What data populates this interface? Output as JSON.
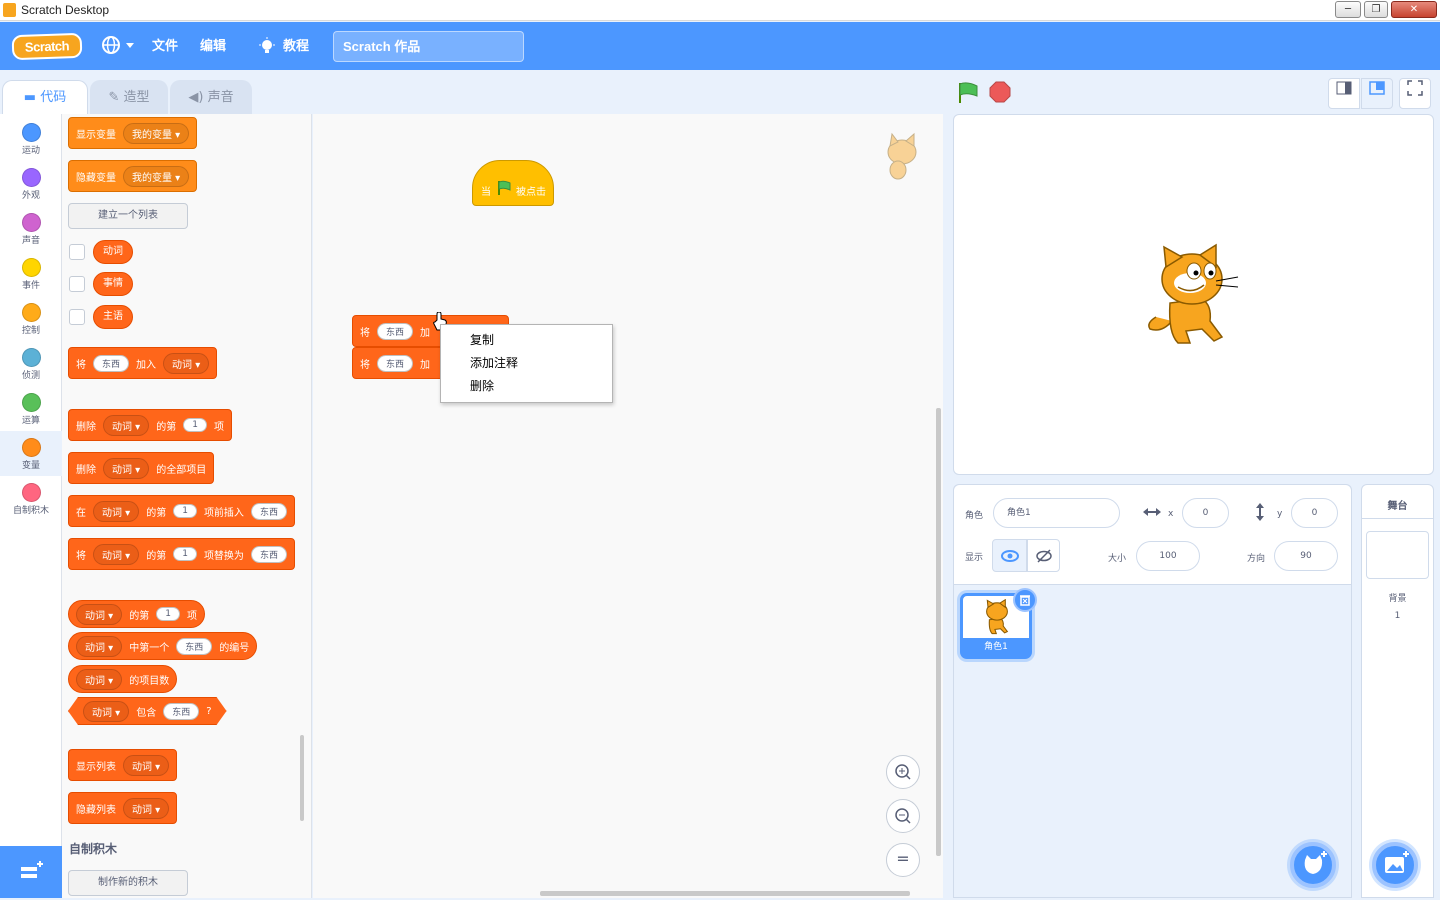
{
  "window": {
    "title": "Scratch Desktop",
    "buttons": [
      "─",
      "❐",
      "✕"
    ]
  },
  "menubar": {
    "logo": "Scratch",
    "file": "文件",
    "edit": "编辑",
    "tutorials": "教程",
    "project_title": "Scratch 作品"
  },
  "tabs": {
    "code": "代码",
    "costumes": "造型",
    "sounds": "声音"
  },
  "categories": [
    {
      "label": "运动",
      "color": "#4c97ff"
    },
    {
      "label": "外观",
      "color": "#9966ff"
    },
    {
      "label": "声音",
      "color": "#cf63cf"
    },
    {
      "label": "事件",
      "color": "#ffd500"
    },
    {
      "label": "控制",
      "color": "#ffab19"
    },
    {
      "label": "侦测",
      "color": "#5cb1d6"
    },
    {
      "label": "运算",
      "color": "#59c059"
    },
    {
      "label": "变量",
      "color": "#ff8c1a"
    },
    {
      "label": "自制积木",
      "color": "#ff6680"
    }
  ],
  "palette": {
    "show_var": "显示变量",
    "hide_var": "隐藏变量",
    "my_var": "我的变量",
    "make_list": "建立一个列表",
    "lists": [
      "动词",
      "事情",
      "主语"
    ],
    "add": {
      "verb": "将",
      "item": "东西",
      "mid": "加入",
      "list": "动词"
    },
    "delete": {
      "verb": "删除",
      "list": "动词",
      "of": "的第",
      "n": "1",
      "tail": "项"
    },
    "delete_all": {
      "verb": "删除",
      "list": "动词",
      "tail": "的全部项目"
    },
    "insert": {
      "verb": "在",
      "list": "动词",
      "of": "的第",
      "n": "1",
      "tail": "项前插入",
      "item": "东西"
    },
    "replace": {
      "verb": "将",
      "list": "动词",
      "of": "的第",
      "n": "1",
      "tail": "项替换为",
      "item": "东西"
    },
    "item_of": {
      "list": "动词",
      "of": "的第",
      "n": "1",
      "tail": "项"
    },
    "index_of": {
      "list": "动词",
      "mid": "中第一个",
      "item": "东西",
      "tail": "的编号"
    },
    "length": {
      "list": "动词",
      "tail": "的项目数"
    },
    "contains": {
      "list": "动词",
      "mid": "包含",
      "item": "东西",
      "tail": "?"
    },
    "show_list": {
      "verb": "显示列表",
      "list": "动词"
    },
    "hide_list": {
      "verb": "隐藏列表",
      "list": "动词"
    },
    "my_blocks_title": "自制积木",
    "make_block": "制作新的积木"
  },
  "code": {
    "hat": {
      "when": "当",
      "clicked": "被点击"
    },
    "block1": {
      "verb": "将",
      "item": "东西",
      "mid": "加"
    },
    "block2": {
      "verb": "将",
      "item": "东西",
      "mid": "加"
    }
  },
  "context_menu": [
    "复制",
    "添加注释",
    "删除"
  ],
  "zoom": {
    "in": "+",
    "out": "−",
    "reset": "="
  },
  "sprite": {
    "label": "角色",
    "name": "角色1",
    "x_label": "x",
    "x": "0",
    "y_label": "y",
    "y": "0",
    "show_label": "显示",
    "size_label": "大小",
    "size": "100",
    "direction_label": "方向",
    "direction": "90",
    "tile_name": "角色1"
  },
  "stage_panel": {
    "title": "舞台",
    "backdrops_label": "背景",
    "backdrops_count": "1"
  },
  "colors": {
    "accent": "#4c97ff",
    "variables": "#ff8c1a",
    "lists": "#ff661a",
    "events": "#ffbf00"
  }
}
